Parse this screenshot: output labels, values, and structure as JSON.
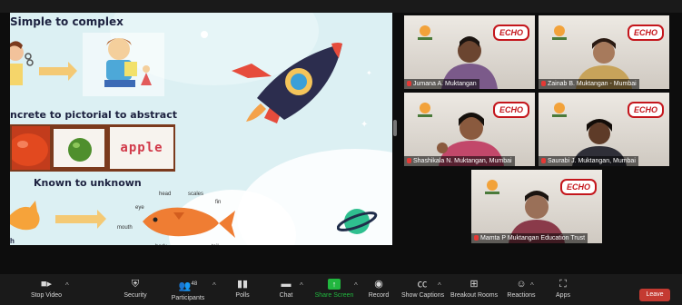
{
  "slide": {
    "heading1": "Simple to complex",
    "heading2": "ncrete to pictorial  to abstract",
    "heading3": "Known to unknown",
    "word_card": "apple",
    "fish_labels": [
      "head",
      "scales",
      "fin",
      "eye",
      "mouth",
      "body",
      "tail"
    ],
    "bottom_left_fragment": "h"
  },
  "participants": [
    {
      "name": "Jumana A. Muktangan",
      "logo": "ECHO"
    },
    {
      "name": "Zainab B. Muktangan - Mumbai",
      "logo": "ECHO"
    },
    {
      "name": "Shashikala N. Muktangan, Mumbai",
      "logo": "ECHO"
    },
    {
      "name": "Saurabi J. Muktangan, Mumbai",
      "logo": "ECHO"
    },
    {
      "name": "Mamta P Muktangan Education Trust",
      "logo": "ECHO"
    }
  ],
  "toolbar": {
    "stop_video": "Stop Video",
    "security": "Security",
    "participants": "Participants",
    "participants_count": "48",
    "polls": "Polls",
    "chat": "Chat",
    "share_screen": "Share Screen",
    "record": "Record",
    "show_captions": "Show Captions",
    "breakout_rooms": "Breakout Rooms",
    "reactions": "Reactions",
    "apps": "Apps",
    "leave": "Leave"
  },
  "colors": {
    "share_screen_accent": "#21b73f",
    "leave_button": "#c43a31",
    "active_speaker_border": "#a7d65a",
    "slide_bg": "#dcf0f3",
    "echo_red": "#c4161c"
  }
}
